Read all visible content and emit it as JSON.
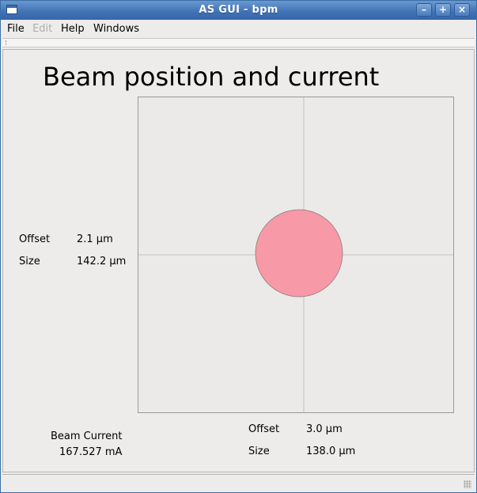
{
  "window": {
    "title": "AS GUI - bpm"
  },
  "menubar": {
    "items": [
      {
        "label": "File",
        "enabled": true
      },
      {
        "label": "Edit",
        "enabled": false
      },
      {
        "label": "Help",
        "enabled": true
      },
      {
        "label": "Windows",
        "enabled": true
      }
    ]
  },
  "main": {
    "heading": "Beam position and current",
    "vertical": {
      "offset_label": "Offset",
      "offset_value": "2.1 µm",
      "size_label": "Size",
      "size_value": "142.2 µm"
    },
    "horizontal": {
      "offset_label": "Offset",
      "offset_value": "3.0 µm",
      "size_label": "Size",
      "size_value": "138.0 µm"
    },
    "beam_current": {
      "label": "Beam Current",
      "value": "167.527 mA"
    }
  },
  "beam_plot": {
    "beam_color": "#f799a6",
    "beam_border_color": "#8f7b7c",
    "crosshair_color": "#d2d0cd",
    "background_color": "#ebeae8"
  }
}
